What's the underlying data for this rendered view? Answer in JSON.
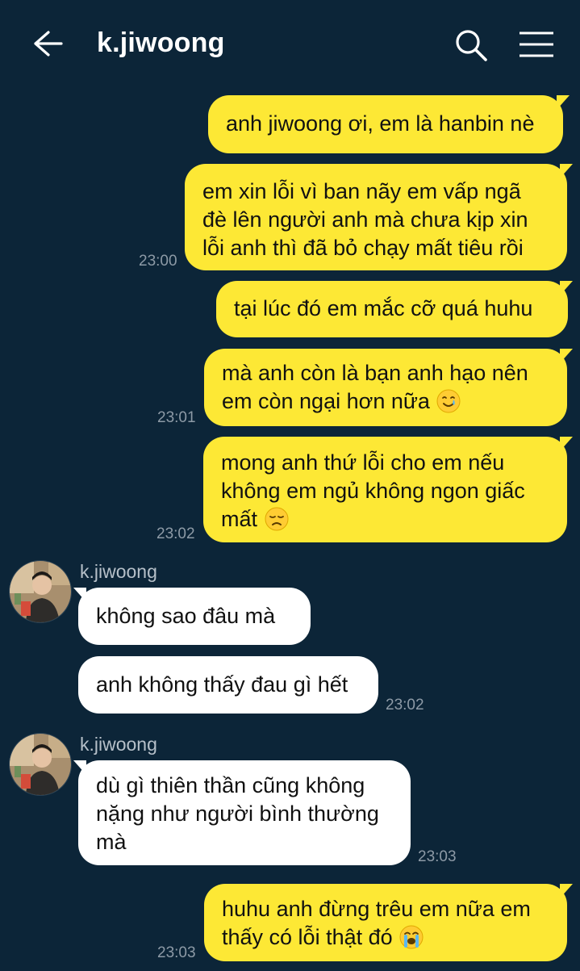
{
  "header": {
    "title": "k.jiwoong",
    "back_icon": "arrow-left-icon",
    "search_icon": "search-icon",
    "menu_icon": "hamburger-menu-icon"
  },
  "colors": {
    "background": "#0c2538",
    "outgoing_bubble": "#fde835",
    "incoming_bubble": "#ffffff",
    "timestamp": "#8d9aa6"
  },
  "messages": [
    {
      "lines": [
        "anh jiwoong ơi, em là hanbin nè"
      ]
    },
    {
      "lines": [
        "em xin lỗi vì ban nãy em vấp ngã",
        "đè lên người anh mà chưa kịp xin",
        "lỗi anh thì đã bỏ chạy mất tiêu rồi"
      ],
      "time": "23:00"
    },
    {
      "lines": [
        "tại lúc đó em mắc cỡ quá huhu"
      ]
    },
    {
      "lines": [
        "mà anh còn là bạn anh hạo nên",
        "em còn ngại hơn nữa"
      ],
      "emoji": "smiling-face-with-tear",
      "time": "23:01"
    },
    {
      "lines": [
        "mong anh thứ lỗi cho em nếu",
        "không em ngủ không ngon giấc",
        "mất"
      ],
      "emoji": "disappointed-face",
      "time": "23:02"
    },
    {
      "sender": "k.jiwoong",
      "lines": [
        "không sao đâu mà"
      ]
    },
    {
      "lines": [
        "anh không thấy đau gì hết"
      ],
      "time": "23:02"
    },
    {
      "sender": "k.jiwoong",
      "lines": [
        "dù gì thiên thần cũng không",
        "nặng như người bình thường",
        "mà"
      ],
      "time": "23:03"
    },
    {
      "lines": [
        "huhu anh đừng trêu em nữa em",
        "thấy có lỗi thật đó"
      ],
      "emoji": "loudly-crying-face",
      "time": "23:03"
    }
  ]
}
